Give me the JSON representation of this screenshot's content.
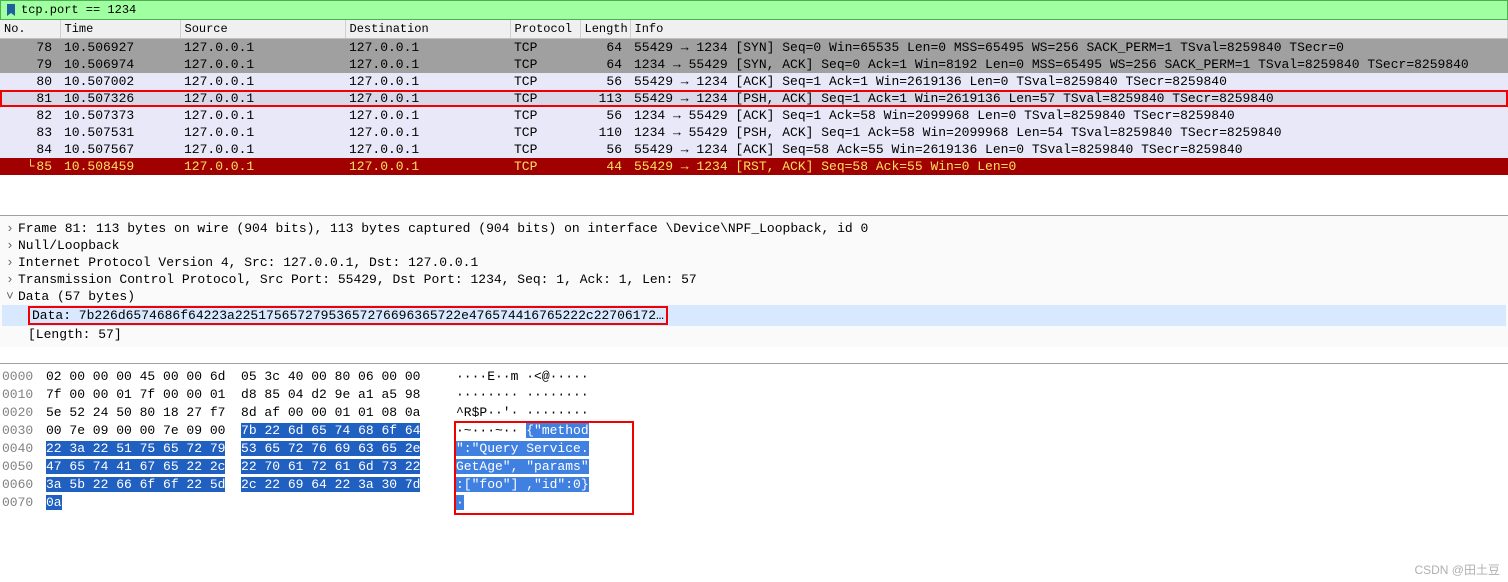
{
  "filter": {
    "text": "tcp.port == 1234"
  },
  "columns": {
    "no": "No.",
    "time": "Time",
    "source": "Source",
    "destination": "Destination",
    "protocol": "Protocol",
    "length": "Length",
    "info": "Info"
  },
  "packets": [
    {
      "no": "78",
      "time": "10.506927",
      "src": "127.0.0.1",
      "dst": "127.0.0.1",
      "proto": "TCP",
      "len": "64",
      "info": "55429 → 1234 [SYN] Seq=0 Win=65535 Len=0 MSS=65495 WS=256 SACK_PERM=1 TSval=8259840 TSecr=0",
      "cls": "row-gray"
    },
    {
      "no": "79",
      "time": "10.506974",
      "src": "127.0.0.1",
      "dst": "127.0.0.1",
      "proto": "TCP",
      "len": "64",
      "info": "1234 → 55429 [SYN, ACK] Seq=0 Ack=1 Win=8192 Len=0 MSS=65495 WS=256 SACK_PERM=1 TSval=8259840 TSecr=8259840",
      "cls": "row-gray"
    },
    {
      "no": "80",
      "time": "10.507002",
      "src": "127.0.0.1",
      "dst": "127.0.0.1",
      "proto": "TCP",
      "len": "56",
      "info": "55429 → 1234 [ACK] Seq=1 Ack=1 Win=2619136 Len=0 TSval=8259840 TSecr=8259840",
      "cls": "row-light"
    },
    {
      "no": "81",
      "time": "10.507326",
      "src": "127.0.0.1",
      "dst": "127.0.0.1",
      "proto": "TCP",
      "len": "113",
      "info": "55429 → 1234 [PSH, ACK] Seq=1 Ack=1 Win=2619136 Len=57 TSval=8259840 TSecr=8259840",
      "cls": "row-sel row-highlight"
    },
    {
      "no": "82",
      "time": "10.507373",
      "src": "127.0.0.1",
      "dst": "127.0.0.1",
      "proto": "TCP",
      "len": "56",
      "info": "1234 → 55429 [ACK] Seq=1 Ack=58 Win=2099968 Len=0 TSval=8259840 TSecr=8259840",
      "cls": "row-light"
    },
    {
      "no": "83",
      "time": "10.507531",
      "src": "127.0.0.1",
      "dst": "127.0.0.1",
      "proto": "TCP",
      "len": "110",
      "info": "1234 → 55429 [PSH, ACK] Seq=1 Ack=58 Win=2099968 Len=54 TSval=8259840 TSecr=8259840",
      "cls": "row-light"
    },
    {
      "no": "84",
      "time": "10.507567",
      "src": "127.0.0.1",
      "dst": "127.0.0.1",
      "proto": "TCP",
      "len": "56",
      "info": "55429 → 1234 [ACK] Seq=58 Ack=55 Win=2619136 Len=0 TSval=8259840 TSecr=8259840",
      "cls": "row-light"
    },
    {
      "no": "85",
      "time": "10.508459",
      "src": "127.0.0.1",
      "dst": "127.0.0.1",
      "proto": "TCP",
      "len": "44",
      "info": "55429 → 1234 [RST, ACK] Seq=58 Ack=55 Win=0 Len=0",
      "cls": "row-red"
    }
  ],
  "details": {
    "frame": "Frame 81: 113 bytes on wire (904 bits), 113 bytes captured (904 bits) on interface \\Device\\NPF_Loopback, id 0",
    "null": "Null/Loopback",
    "ip": "Internet Protocol Version 4, Src: 127.0.0.1, Dst: 127.0.0.1",
    "tcp": "Transmission Control Protocol, Src Port: 55429, Dst Port: 1234, Seq: 1, Ack: 1, Len: 57",
    "data": "Data (57 bytes)",
    "data_hex": "Data: 7b226d6574686f64223a22517565727953657276696365722e476574416765222c22706172…",
    "length": "[Length: 57]"
  },
  "hex": {
    "rows": [
      {
        "off": "0000",
        "b1": "02 00 00 00 45 00 00 6d",
        "b2": "05 3c 40 00 80 06 00 00",
        "ascii": "····E··m ·<@·····"
      },
      {
        "off": "0010",
        "b1": "7f 00 00 01 7f 00 00 01",
        "b2": "d8 85 04 d2 9e a1 a5 98",
        "ascii": "········ ········"
      },
      {
        "off": "0020",
        "b1": "5e 52 24 50 80 18 27 f7",
        "b2": "8d af 00 00 01 01 08 0a",
        "ascii": "^R$P··'· ········"
      },
      {
        "off": "0030",
        "b1": "00 7e 09 00 00 7e 09 00",
        "b2_hl": "7b 22 6d 65 74 68 6f 64",
        "ascii_p": "·~···~·· ",
        "ascii_hl": "{\"method"
      },
      {
        "off": "0040",
        "b1_hl": "22 3a 22 51 75 65 72 79",
        "b2_hl": "53 65 72 76 69 63 65 2e",
        "ascii_hl": "\":\"Query Service."
      },
      {
        "off": "0050",
        "b1_hl": "47 65 74 41 67 65 22 2c",
        "b2_hl": "22 70 61 72 61 6d 73 22",
        "ascii_hl": "GetAge\", \"params\""
      },
      {
        "off": "0060",
        "b1_hl": "3a 5b 22 66 6f 6f 22 5d",
        "b2_hl": "2c 22 69 64 22 3a 30 7d",
        "ascii_hl": ":[\"foo\"] ,\"id\":0}"
      },
      {
        "off": "0070",
        "b1_hl": "0a",
        "b2": "",
        "ascii_hl": "·"
      }
    ]
  },
  "watermark": "CSDN @田土豆"
}
